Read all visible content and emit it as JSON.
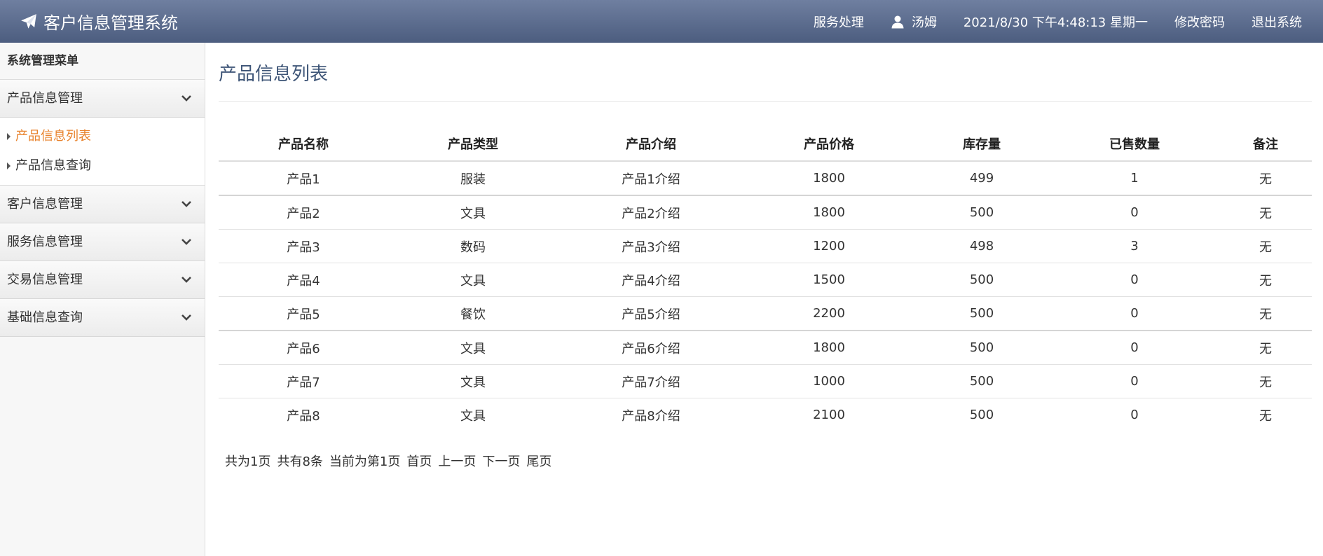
{
  "header": {
    "brand_title": "客户信息管理系统",
    "brand_icon": "paper-plane-icon",
    "nav": {
      "service": "服务处理",
      "user_name": "汤姆",
      "datetime": "2021/8/30 下午4:48:13 星期一",
      "change_password": "修改密码",
      "logout": "退出系统"
    }
  },
  "sidebar": {
    "heading": "系统管理菜单",
    "groups": [
      {
        "label": "产品信息管理",
        "expanded": true,
        "items": [
          {
            "label": "产品信息列表",
            "active": true
          },
          {
            "label": "产品信息查询",
            "active": false
          }
        ]
      },
      {
        "label": "客户信息管理",
        "expanded": false
      },
      {
        "label": "服务信息管理",
        "expanded": false
      },
      {
        "label": "交易信息管理",
        "expanded": false
      },
      {
        "label": "基础信息查询",
        "expanded": false
      }
    ]
  },
  "main": {
    "title": "产品信息列表",
    "columns": [
      "产品名称",
      "产品类型",
      "产品介绍",
      "产品价格",
      "库存量",
      "已售数量",
      "备注"
    ],
    "rows": [
      [
        "产品1",
        "服装",
        "产品1介绍",
        "1800",
        "499",
        "1",
        "无"
      ],
      [
        "产品2",
        "文具",
        "产品2介绍",
        "1800",
        "500",
        "0",
        "无"
      ],
      [
        "产品3",
        "数码",
        "产品3介绍",
        "1200",
        "498",
        "3",
        "无"
      ],
      [
        "产品4",
        "文具",
        "产品4介绍",
        "1500",
        "500",
        "0",
        "无"
      ],
      [
        "产品5",
        "餐饮",
        "产品5介绍",
        "2200",
        "500",
        "0",
        "无"
      ],
      [
        "产品6",
        "文具",
        "产品6介绍",
        "1800",
        "500",
        "0",
        "无"
      ],
      [
        "产品7",
        "文具",
        "产品7介绍",
        "1000",
        "500",
        "0",
        "无"
      ],
      [
        "产品8",
        "文具",
        "产品8介绍",
        "2100",
        "500",
        "0",
        "无"
      ]
    ],
    "pager": {
      "total_pages": "共为1页",
      "total_records": "共有8条",
      "current_page": "当前为第1页",
      "first": "首页",
      "prev": "上一页",
      "next": "下一页",
      "last": "尾页"
    }
  },
  "colors": {
    "header_top": "#6f7fa0",
    "header_bottom": "#4c5d7f",
    "active_item": "#e8822c",
    "title": "#3e5577"
  }
}
